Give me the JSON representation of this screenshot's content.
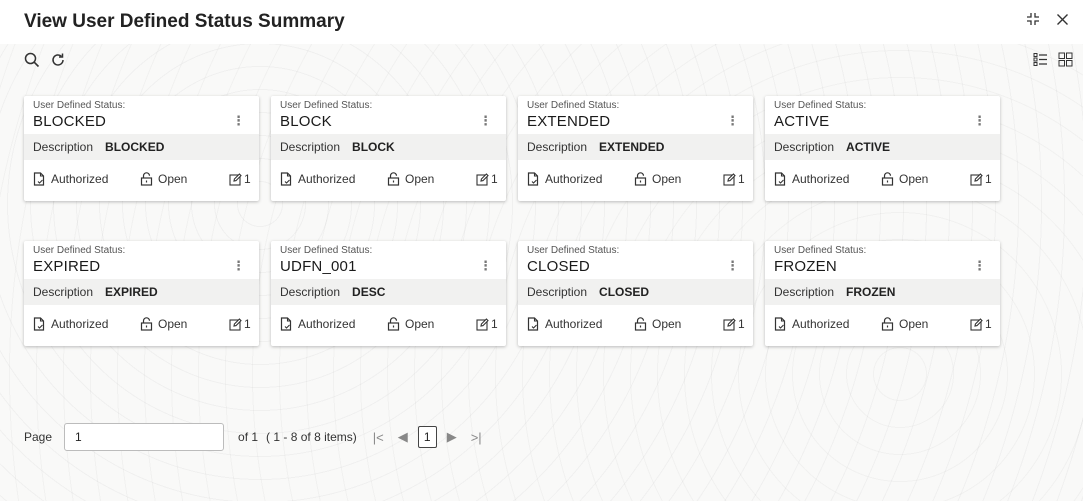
{
  "header": {
    "title": "View User Defined Status Summary"
  },
  "cards": [
    {
      "label": "User Defined Status:",
      "status": "BLOCKED",
      "desc_label": "Description",
      "desc_value": "BLOCKED",
      "auth": "Authorized",
      "open": "Open",
      "count": "1"
    },
    {
      "label": "User Defined Status:",
      "status": "BLOCK",
      "desc_label": "Description",
      "desc_value": "BLOCK",
      "auth": "Authorized",
      "open": "Open",
      "count": "1"
    },
    {
      "label": "User Defined Status:",
      "status": "EXTENDED",
      "desc_label": "Description",
      "desc_value": "EXTENDED",
      "auth": "Authorized",
      "open": "Open",
      "count": "1"
    },
    {
      "label": "User Defined Status:",
      "status": "ACTIVE",
      "desc_label": "Description",
      "desc_value": "ACTIVE",
      "auth": "Authorized",
      "open": "Open",
      "count": "1"
    },
    {
      "label": "User Defined Status:",
      "status": "EXPIRED",
      "desc_label": "Description",
      "desc_value": "EXPIRED",
      "auth": "Authorized",
      "open": "Open",
      "count": "1"
    },
    {
      "label": "User Defined Status:",
      "status": "UDFN_001",
      "desc_label": "Description",
      "desc_value": "DESC",
      "auth": "Authorized",
      "open": "Open",
      "count": "1"
    },
    {
      "label": "User Defined Status:",
      "status": "CLOSED",
      "desc_label": "Description",
      "desc_value": "CLOSED",
      "auth": "Authorized",
      "open": "Open",
      "count": "1"
    },
    {
      "label": "User Defined Status:",
      "status": "FROZEN",
      "desc_label": "Description",
      "desc_value": "FROZEN",
      "auth": "Authorized",
      "open": "Open",
      "count": "1"
    }
  ],
  "pager": {
    "page_label": "Page",
    "page_value": "1",
    "of_text": "of 1",
    "range_text": "( 1 - 8 of 8 items)",
    "current": "1"
  },
  "icons": {
    "search": "search-icon",
    "refresh": "refresh-icon",
    "list_view": "list-view-icon",
    "grid_view": "grid-view-icon",
    "minimize": "minimize-icon",
    "close": "close-icon"
  }
}
